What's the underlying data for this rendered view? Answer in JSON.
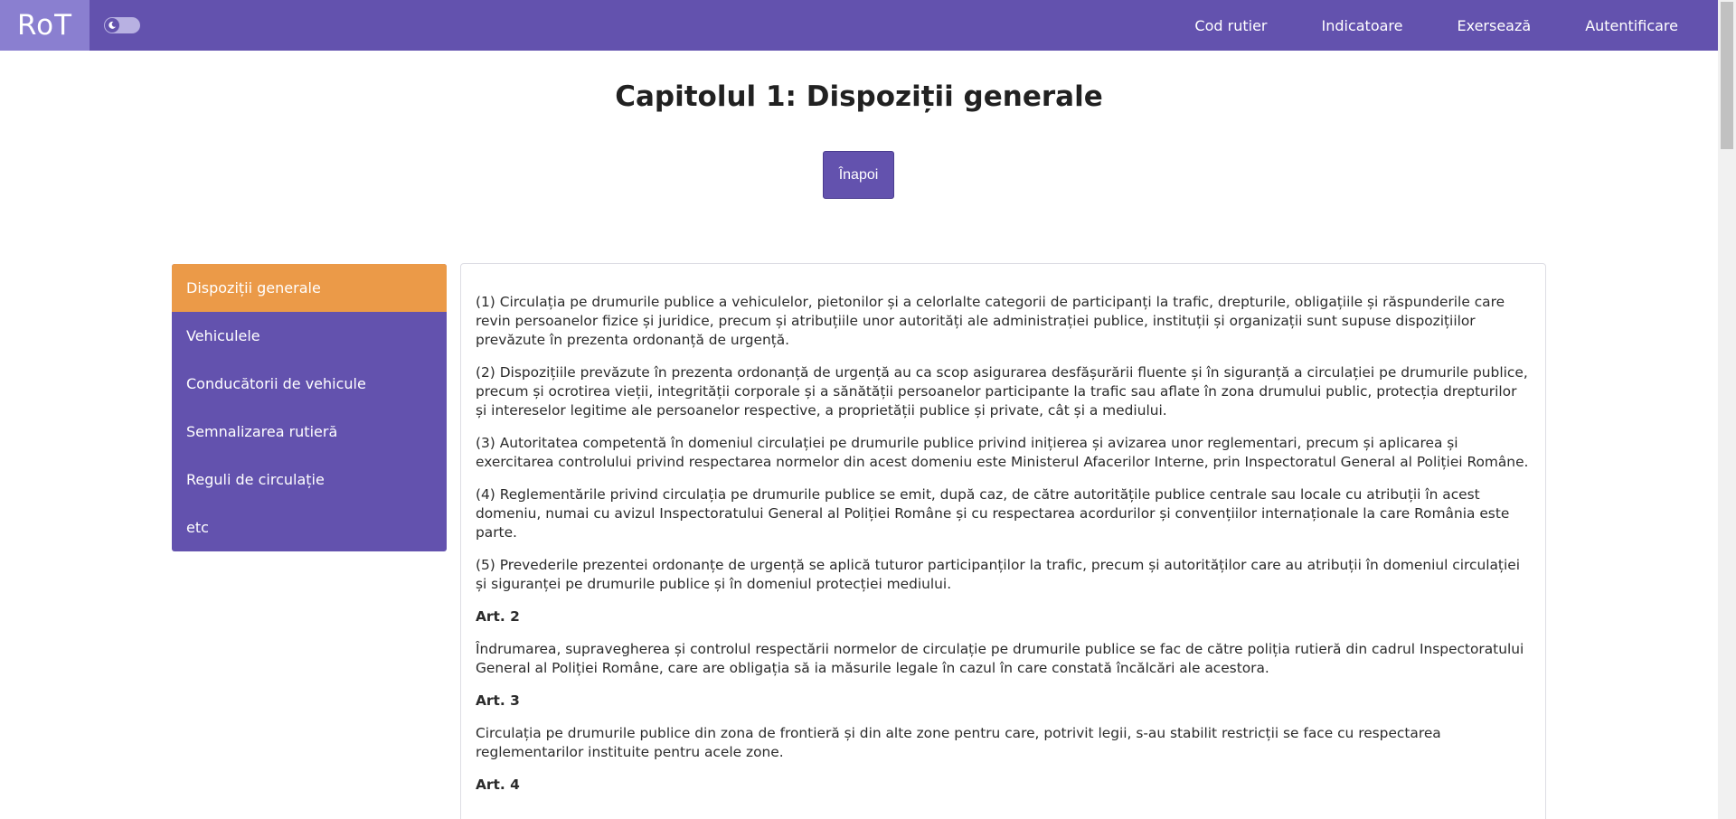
{
  "navbar": {
    "brand": "RoT",
    "links": [
      "Cod rutier",
      "Indicatoare",
      "Exersează",
      "Autentificare"
    ]
  },
  "page": {
    "title": "Capitolul 1: Dispoziții generale",
    "back_label": "Înapoi"
  },
  "sidebar": {
    "items": [
      {
        "label": "Dispoziții generale",
        "active": true
      },
      {
        "label": "Vehiculele"
      },
      {
        "label": "Conducătorii de vehicule"
      },
      {
        "label": "Semnalizarea rutieră"
      },
      {
        "label": "Reguli de circulație"
      },
      {
        "label": "etc"
      }
    ]
  },
  "content": {
    "p1": "(1) Circulația pe drumurile publice a vehiculelor, pietonilor și a celorlalte categorii de participanți la trafic, drepturile, obligațiile și răspunderile care revin persoanelor fizice și juridice, precum și atribuțiile unor autorități ale administrației publice, instituții și organizații sunt supuse dispozițiilor prevăzute în prezenta ordonanță de urgență.",
    "p2": "(2) Dispozițiile prevăzute în prezenta ordonanță de urgență au ca scop asigurarea desfășurării fluente și în siguranță a circulației pe drumurile publice, precum și ocrotirea vieții, integrității corporale și a sănătății persoanelor participante la trafic sau aflate în zona drumului public, protecția drepturilor și intereselor legitime ale persoanelor respective, a proprietății publice și private, cât și a mediului.",
    "p3": "(3) Autoritatea competentă în domeniul circulației pe drumurile publice privind inițierea și avizarea unor reglementari, precum și aplicarea și exercitarea controlului privind respectarea normelor din acest domeniu este Ministerul Afacerilor Interne, prin Inspectoratul General al Poliției Române.",
    "p4": "(4) Reglementările privind circulația pe drumurile publice se emit, după caz, de către autoritățile publice centrale sau locale cu atribuții în acest domeniu, numai cu avizul Inspectoratului General al Poliției Române și cu respectarea acordurilor și convențiilor internaționale la care România este parte.",
    "p5": "(5) Prevederile prezentei ordonanțe de urgență se aplică tuturor participanților la trafic, precum și autorităților care au atribuții în domeniul circulației și siguranței pe drumurile publice și în domeniul protecției mediului.",
    "art2_title": "Art. 2",
    "art2_text": "Îndrumarea, supravegherea și controlul respectării normelor de circulație pe drumurile publice se fac de către poliția rutieră din cadrul Inspectoratului General al Poliției Române, care are obligația să ia măsurile legale în cazul în care constată încălcări ale acestora.",
    "art3_title": "Art. 3",
    "art3_text": "Circulația pe drumurile publice din zona de frontieră și din alte zone pentru care, potrivit legii, s-au stabilit restricții se face cu respectarea reglementarilor instituite pentru acele zone.",
    "art4_title": "Art. 4"
  }
}
